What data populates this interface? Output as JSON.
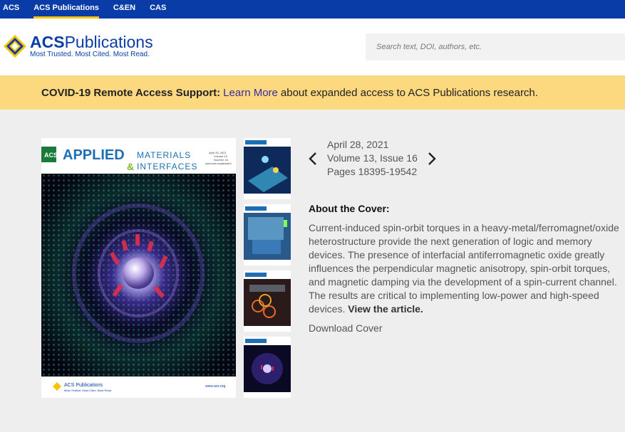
{
  "topnav": {
    "items": [
      {
        "label": "ACS"
      },
      {
        "label": "ACS Publications"
      },
      {
        "label": "C&EN"
      },
      {
        "label": "CAS"
      }
    ]
  },
  "header": {
    "logo_title_bold": "ACS",
    "logo_title_rest": "Publications",
    "logo_tagline": "Most Trusted. Most Cited. Most Read.",
    "search_placeholder": "Search text, DOI, authors, etc."
  },
  "banner": {
    "bold": "COVID-19 Remote Access Support:",
    "link": "Learn More",
    "rest": "about expanded access to ACS Publications research."
  },
  "cover": {
    "journal_acs": "ACS",
    "journal_applied": "APPLIED",
    "journal_materials": "MATERIALS",
    "journal_interfaces": "INTERFACES",
    "cover_date": "April 28, 2021",
    "cover_volume": "Volume 13",
    "cover_number": "Number 16",
    "cover_url_top": "www.acs.org/acsami",
    "footer_logo": "ACS Publications",
    "footer_tagline": "Most Trusted. Most Cited. Most Read.",
    "footer_url": "www.acs.org"
  },
  "issue": {
    "date": "April 28, 2021",
    "volume": "Volume 13, Issue 16",
    "pages": "Pages 18395-19542"
  },
  "about": {
    "heading": "About the Cover:",
    "text": "Current-induced spin-orbit torques in a heavy-metal/ferromagnet/oxide heterostructure provide the next generation of logic and memory devices. The presence of interfacial antiferromagnetic oxide greatly influences the perpendicular magnetic anisotropy, spin-orbit torques, and magnetic damping via the development of a spin-current channel. The results are critical to implementing low-power and high-speed devices.",
    "link": "View the article.",
    "download": "Download Cover"
  },
  "colors": {
    "nav_blue": "#0a3ca8",
    "accent_yellow": "#f5c300",
    "banner_bg": "#fcd97f",
    "link_purple": "#3b2aa0"
  }
}
